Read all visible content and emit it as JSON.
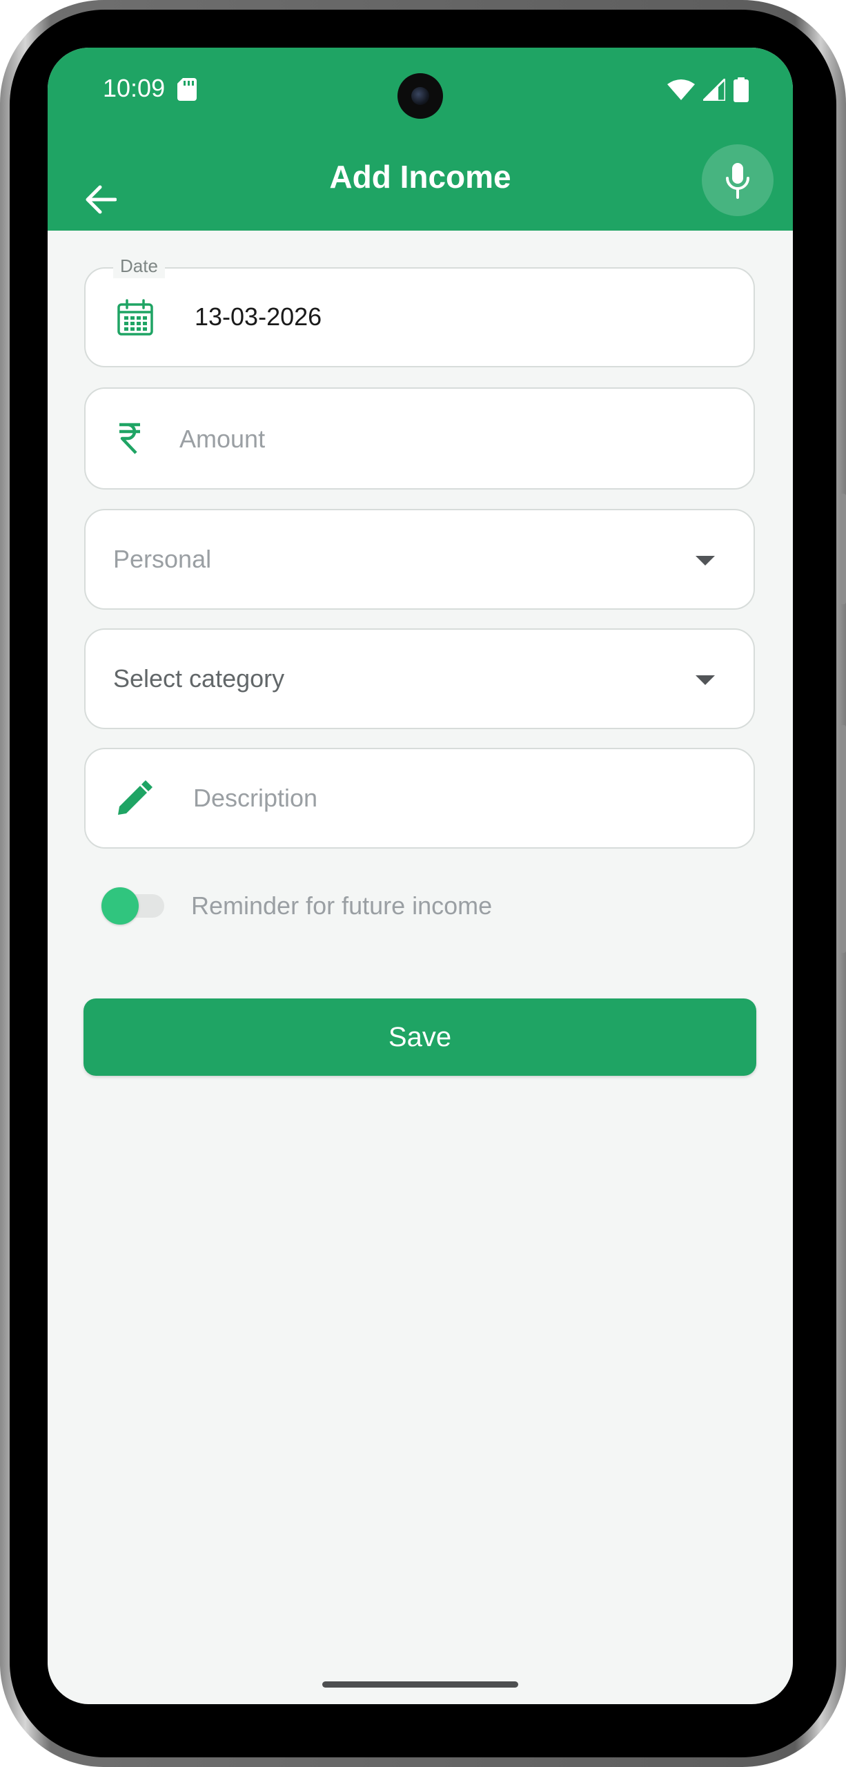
{
  "status_bar": {
    "time": "10:09",
    "icons": [
      "sd-card-icon",
      "wifi-icon",
      "cellular-icon",
      "battery-icon"
    ]
  },
  "app_bar": {
    "title": "Add Income",
    "back_icon": "arrow-back-icon",
    "mic_icon": "mic-icon"
  },
  "form": {
    "date": {
      "label": "Date",
      "value": "13-03-2026",
      "icon": "calendar-icon"
    },
    "amount": {
      "placeholder": "Amount",
      "icon": "rupee-icon"
    },
    "account": {
      "selected": "Personal",
      "icon": "dropdown-arrow-icon"
    },
    "category": {
      "selected": "Select category",
      "icon": "dropdown-arrow-icon"
    },
    "description": {
      "placeholder": "Description",
      "icon": "pencil-icon"
    },
    "reminder": {
      "label": "Reminder for future income",
      "enabled": false
    },
    "save_label": "Save"
  },
  "colors": {
    "primary": "#1fa464",
    "toggle_thumb": "#30c57e",
    "background": "#f4f6f5",
    "field_border": "#d7dcda",
    "placeholder": "#9a9fa3"
  }
}
